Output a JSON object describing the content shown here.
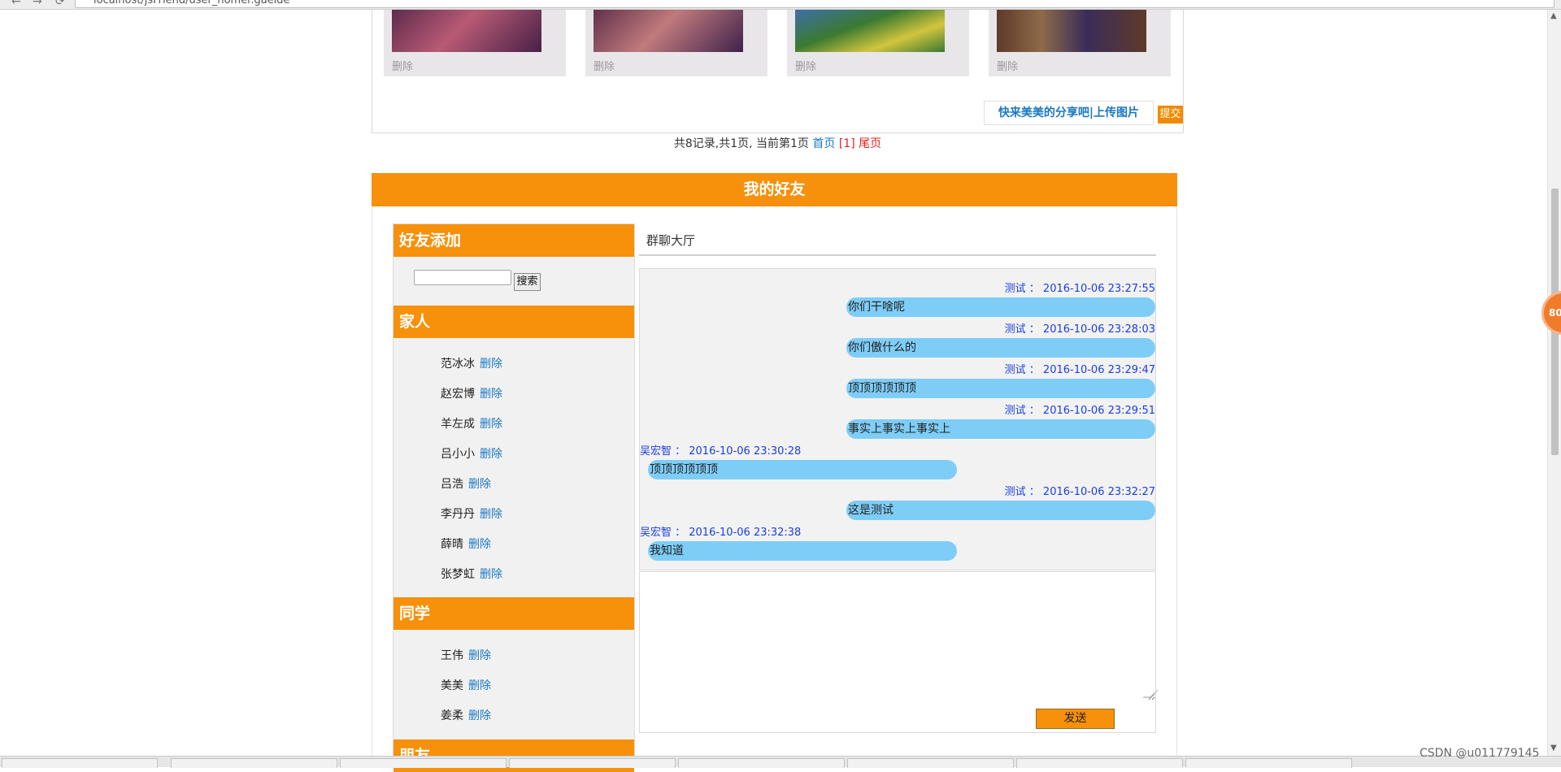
{
  "browser": {
    "address": "localhost/jsFriend/user_homer.gaelde",
    "nav": [
      "←",
      "→",
      "⟳"
    ]
  },
  "photos": {
    "items": [
      {
        "delete_label": "删除",
        "colors": [
          "#5e2b4c",
          "#b85a74",
          "#472046"
        ]
      },
      {
        "delete_label": "删除",
        "colors": [
          "#60314b",
          "#c07a7c",
          "#3f214b"
        ]
      },
      {
        "delete_label": "删除",
        "colors": [
          "#3b7a31",
          "#d2c53e",
          "#3d6ea8"
        ]
      },
      {
        "delete_label": "删除",
        "colors": [
          "#5e3a2a",
          "#3a2d58",
          "#8d6a49"
        ]
      }
    ],
    "upload_label": "快来美美的分享吧|上传图片",
    "submit_label": "提交"
  },
  "pagination": {
    "summary": "共8记录,共1页, 当前第1页",
    "first": "首页",
    "current": "[1]",
    "last": "尾页"
  },
  "friends": {
    "title": "我的好友",
    "add_section": {
      "title": "好友添加",
      "search_value": "",
      "search_button": "搜索"
    },
    "groups": [
      {
        "name": "家人",
        "members": [
          {
            "name": "范冰冰",
            "action": "删除"
          },
          {
            "name": "赵宏博",
            "action": "删除"
          },
          {
            "name": "羊左成",
            "action": "删除"
          },
          {
            "name": "吕小小",
            "action": "删除"
          },
          {
            "name": "吕浩",
            "action": "删除"
          },
          {
            "name": "李丹丹",
            "action": "删除"
          },
          {
            "name": "薛晴",
            "action": "删除"
          },
          {
            "name": "张梦虹",
            "action": "删除"
          }
        ]
      },
      {
        "name": "同学",
        "members": [
          {
            "name": "王伟",
            "action": "删除"
          },
          {
            "name": "美美",
            "action": "删除"
          },
          {
            "name": "姜柔",
            "action": "删除"
          }
        ]
      },
      {
        "name": "朋友",
        "members": []
      }
    ]
  },
  "chat": {
    "title": "群聊大厅",
    "messages": [
      {
        "meta": "测试 ： 2016-10-06 23:27:55",
        "text": "你们干啥呢",
        "side": "right"
      },
      {
        "meta": "测试 ： 2016-10-06 23:28:03",
        "text": "你们傲什么的",
        "side": "right"
      },
      {
        "meta": "测试 ： 2016-10-06 23:29:47",
        "text": "顶顶顶顶顶顶",
        "side": "right"
      },
      {
        "meta": "测试 ： 2016-10-06 23:29:51",
        "text": "事实上事实上事实上",
        "side": "right"
      },
      {
        "meta": "吴宏智 ： 2016-10-06 23:30:28",
        "text": "顶顶顶顶顶顶",
        "side": "left"
      },
      {
        "meta": "测试 ： 2016-10-06 23:32:27",
        "text": "这是测试",
        "side": "right"
      },
      {
        "meta": "吴宏智 ： 2016-10-06 23:32:38",
        "text": "我知道",
        "side": "left"
      }
    ],
    "compose_value": "",
    "send_label": "发送"
  },
  "badge": {
    "label": "80"
  },
  "watermark": "CSDN @u011779145",
  "colors": {
    "accent": "#f7900a",
    "bubble": "#7ecdf7",
    "link": "#1a78c2",
    "meta": "#1a3ee0",
    "sidebar": "#f2f1f2"
  }
}
